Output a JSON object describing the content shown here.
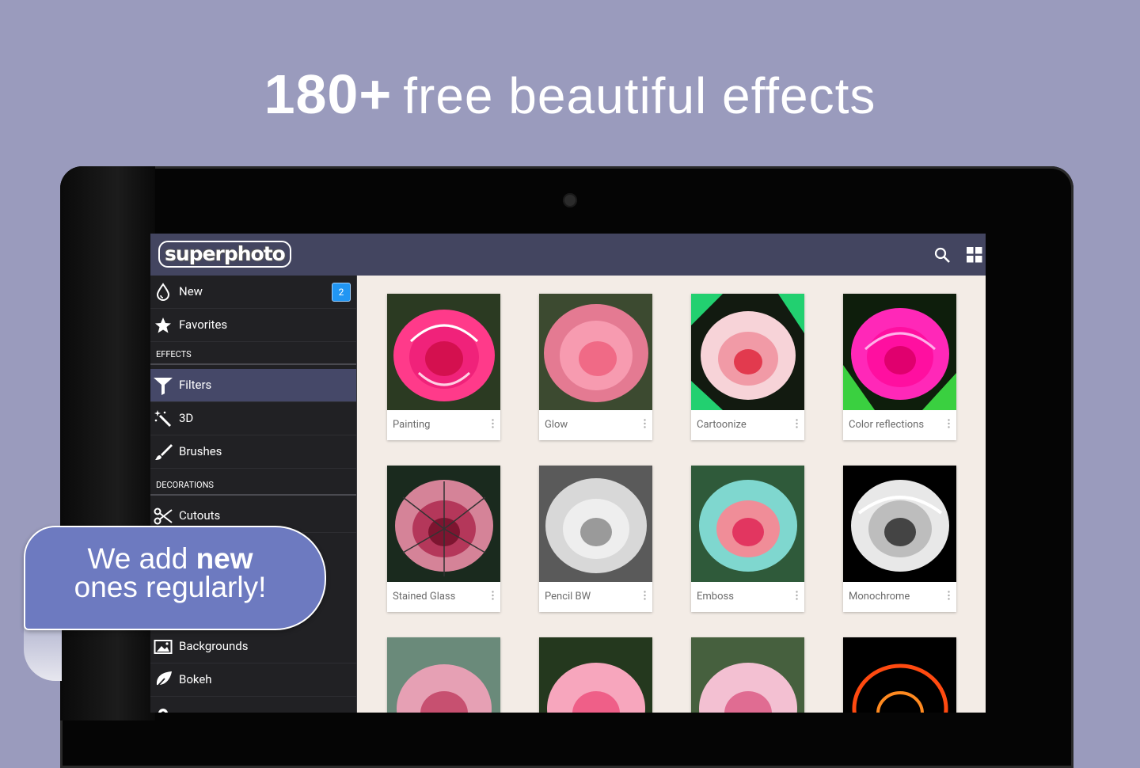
{
  "headline": {
    "number": "180+",
    "rest": "free beautiful effects"
  },
  "app": {
    "logo": "superphoto"
  },
  "drawer": {
    "items": [
      {
        "label": "New",
        "icon": "drop-icon",
        "badge": "2"
      },
      {
        "label": "Favorites",
        "icon": "star-icon"
      }
    ],
    "sections": [
      {
        "title": "EFFECTS",
        "items": [
          {
            "label": "Filters",
            "icon": "filter-funnel-icon",
            "active": true
          },
          {
            "label": "3D",
            "icon": "magic-wand-icon"
          },
          {
            "label": "Brushes",
            "icon": "brush-icon"
          }
        ]
      },
      {
        "title": "DECORATIONS",
        "items": [
          {
            "label": "Cutouts",
            "icon": "scissors-icon"
          },
          {
            "label": "Backgrounds",
            "icon": "image-icon"
          },
          {
            "label": "Bokeh",
            "icon": "leaf-icon"
          }
        ]
      }
    ]
  },
  "effects": [
    {
      "name": "Painting"
    },
    {
      "name": "Glow"
    },
    {
      "name": "Cartoonize"
    },
    {
      "name": "Color reflections"
    },
    {
      "name": "Stained Glass"
    },
    {
      "name": "Pencil BW"
    },
    {
      "name": "Emboss"
    },
    {
      "name": "Monochrome"
    }
  ],
  "bubble": {
    "line1a": "We add ",
    "line1b": "new",
    "line2": "ones regularly!"
  },
  "colors": {
    "background": "#9a9bbd",
    "appbar": "#434560",
    "drawer": "#212124",
    "active": "#454868",
    "badge": "#2196f3",
    "bubble": "#6d7ac0"
  }
}
